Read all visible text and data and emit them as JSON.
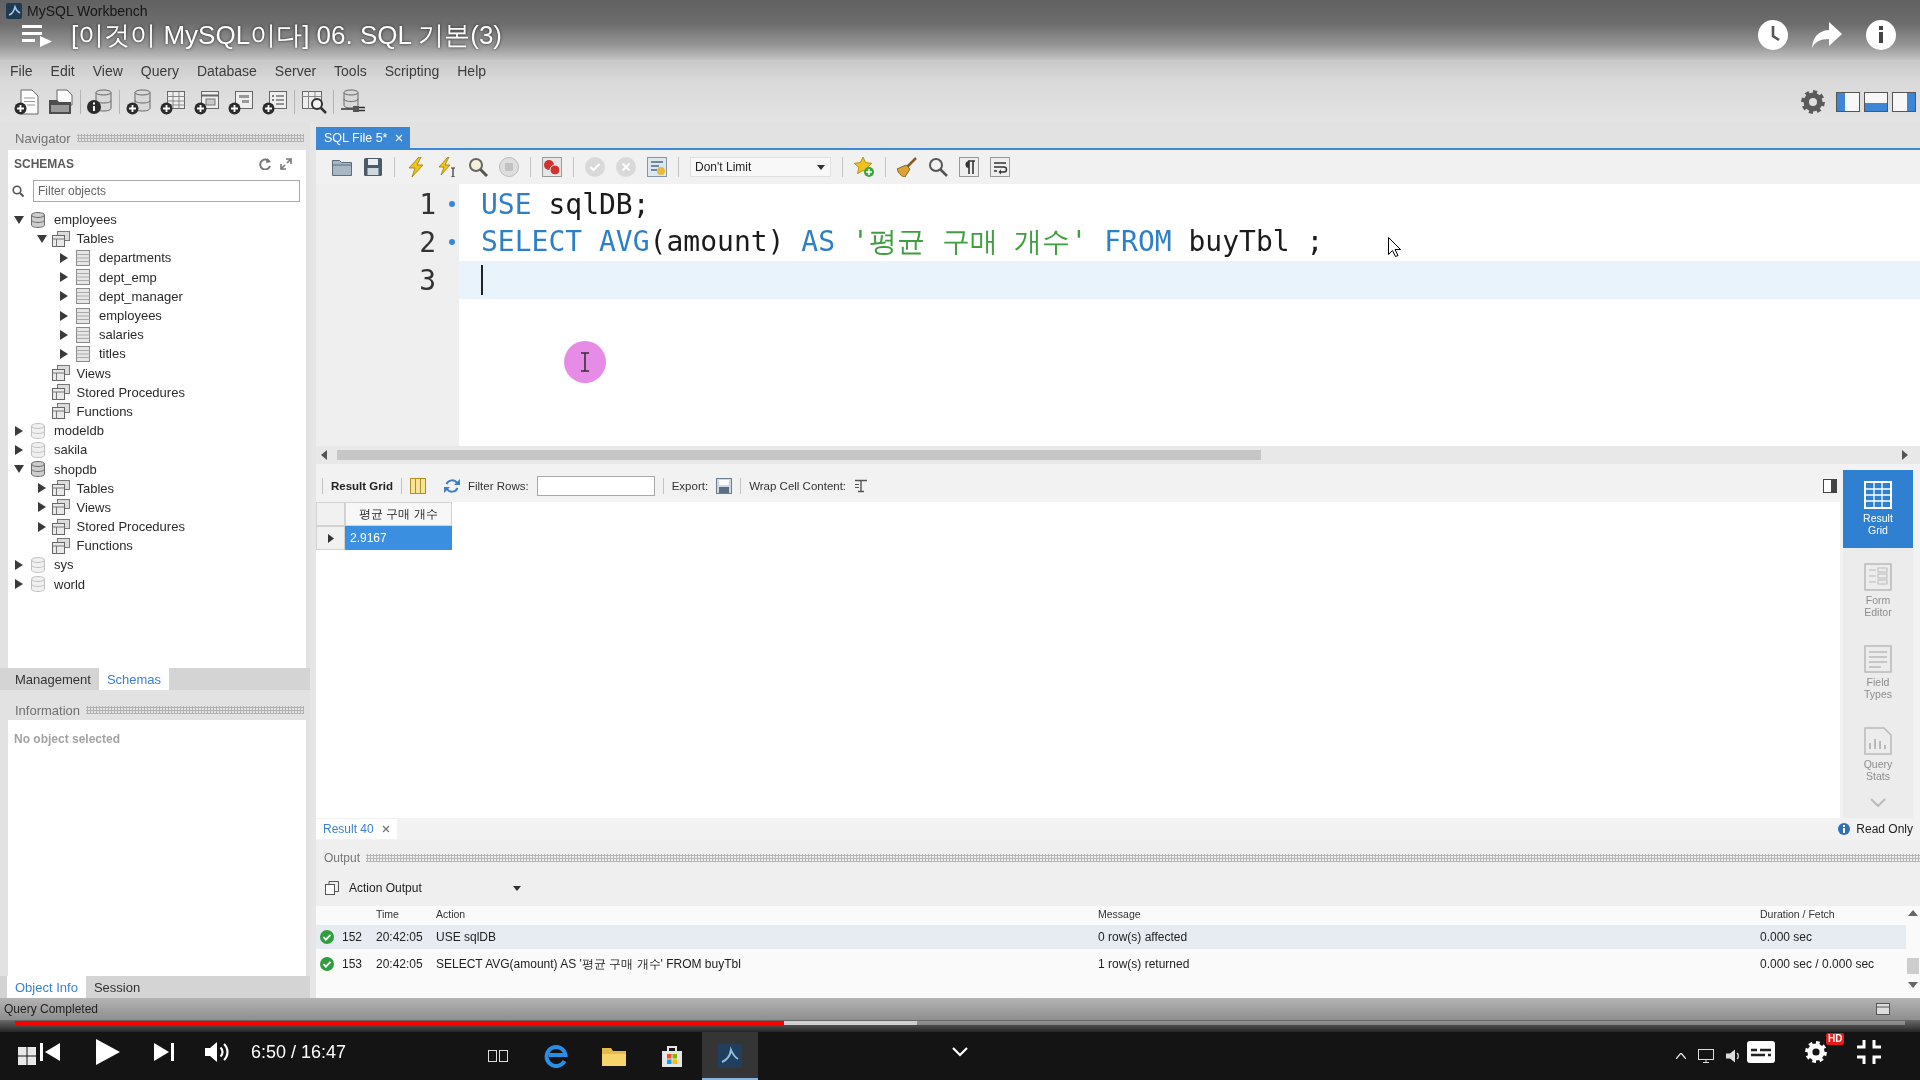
{
  "app_window": {
    "title": "MySQL Workbench"
  },
  "video": {
    "title": "[이것이 MySQL이다] 06. SQL 기본(3)"
  },
  "menu": [
    "File",
    "Edit",
    "View",
    "Query",
    "Database",
    "Server",
    "Tools",
    "Scripting",
    "Help"
  ],
  "navigator": {
    "title": "Navigator",
    "section": "SCHEMAS",
    "filter": {
      "placeholder": "Filter objects"
    },
    "tree": [
      {
        "label": "employees",
        "kind": "schema",
        "expanded": true,
        "children": [
          {
            "label": "Tables",
            "kind": "folder",
            "expanded": true,
            "children": [
              {
                "label": "departments",
                "kind": "table",
                "expanded": false
              },
              {
                "label": "dept_emp",
                "kind": "table",
                "expanded": false
              },
              {
                "label": "dept_manager",
                "kind": "table",
                "expanded": false
              },
              {
                "label": "employees",
                "kind": "table",
                "expanded": false
              },
              {
                "label": "salaries",
                "kind": "table",
                "expanded": false
              },
              {
                "label": "titles",
                "kind": "table",
                "expanded": false
              }
            ]
          },
          {
            "label": "Views",
            "kind": "folder",
            "expanded": true
          },
          {
            "label": "Stored Procedures",
            "kind": "folder",
            "expanded": true
          },
          {
            "label": "Functions",
            "kind": "folder",
            "expanded": true
          }
        ]
      },
      {
        "label": "modeldb",
        "kind": "schema",
        "expanded": false
      },
      {
        "label": "sakila",
        "kind": "schema",
        "expanded": false
      },
      {
        "label": "shopdb",
        "kind": "schema",
        "expanded": true,
        "children": [
          {
            "label": "Tables",
            "kind": "folder",
            "expanded": false
          },
          {
            "label": "Views",
            "kind": "folder",
            "expanded": false
          },
          {
            "label": "Stored Procedures",
            "kind": "folder",
            "expanded": false
          },
          {
            "label": "Functions",
            "kind": "folder",
            "expanded": true
          }
        ]
      },
      {
        "label": "sys",
        "kind": "schema",
        "expanded": false
      },
      {
        "label": "world",
        "kind": "schema",
        "expanded": false
      }
    ],
    "tabs": [
      {
        "label": "Management",
        "selected": false
      },
      {
        "label": "Schemas",
        "selected": true
      }
    ],
    "info_title": "Information",
    "info_text": "No object selected",
    "info_tabs": [
      {
        "label": "Object Info",
        "selected": true
      },
      {
        "label": "Session",
        "selected": false
      }
    ]
  },
  "editor": {
    "tabs": [
      {
        "label": "SQL File 5*",
        "selected": true
      }
    ],
    "row_limit": "Don't Limit",
    "lines": [
      {
        "number": "1",
        "marker": true,
        "current": false,
        "tokens": [
          {
            "kind": "keyword",
            "text": "USE"
          },
          {
            "kind": "plain",
            "text": " sqlDB;"
          }
        ]
      },
      {
        "number": "2",
        "marker": true,
        "current": false,
        "tokens": [
          {
            "kind": "keyword",
            "text": "SELECT"
          },
          {
            "kind": "keyword",
            "text": " AVG"
          },
          {
            "kind": "plain",
            "text": "(amount) "
          },
          {
            "kind": "keyword",
            "text": "AS"
          },
          {
            "kind": "string",
            "text": " '평균 구매 개수'"
          },
          {
            "kind": "keyword",
            "text": " FROM"
          },
          {
            "kind": "plain",
            "text": " buyTbl ;"
          }
        ]
      },
      {
        "number": "3",
        "marker": false,
        "current": true
      }
    ]
  },
  "result": {
    "title": "Result Grid",
    "filter_label": "Filter Rows:",
    "export_label": "Export:",
    "wrap_label": "Wrap Cell Content:",
    "columns": [
      "평균 구매 개수"
    ],
    "rows": [
      {
        "cells": [
          "2.9167"
        ],
        "selected": true
      }
    ],
    "views": [
      {
        "kind": "grid",
        "label": "Result Grid",
        "selected": true
      },
      {
        "kind": "form",
        "label": "Form Editor",
        "selected": false
      },
      {
        "kind": "fields",
        "label": "Field Types",
        "selected": false
      },
      {
        "kind": "stats",
        "label": "Query Stats",
        "selected": false
      }
    ],
    "tabs": [
      {
        "label": "Result 40",
        "selected": true
      }
    ],
    "mode": "Read Only"
  },
  "output": {
    "title": "Output",
    "mode": "Action Output",
    "columns": [
      "Time",
      "Action",
      "Message",
      "Duration / Fetch"
    ],
    "rows": [
      {
        "kind": "success",
        "number": "152",
        "time": "20:42:05",
        "action": "USE sqlDB",
        "message": "0 row(s) affected",
        "duration": "0.000 sec"
      },
      {
        "kind": "success",
        "number": "153",
        "time": "20:42:05",
        "action": "SELECT AVG(amount) AS '평균 구매 개수' FROM buyTbl",
        "message": "1 row(s) returned",
        "duration": "0.000 sec / 0.000 sec"
      }
    ]
  },
  "status_bar": {
    "text": "Query Completed"
  },
  "player": {
    "progress": {
      "level": 0.407
    },
    "buffer": {
      "level": 0.477
    },
    "time": "6:50 / 16:47",
    "quality": "HD"
  }
}
